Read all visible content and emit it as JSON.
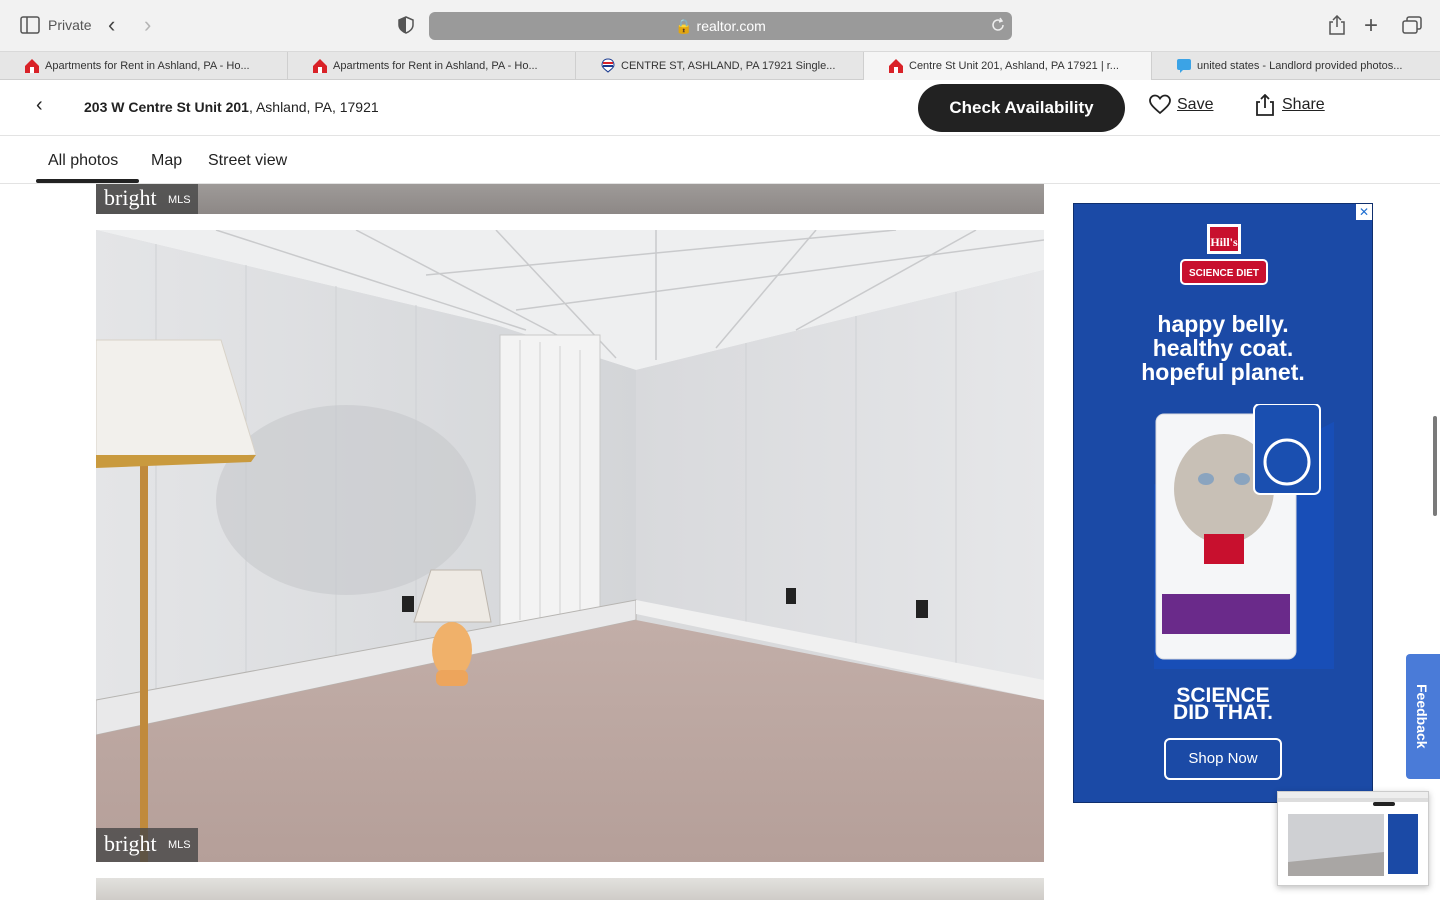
{
  "browser": {
    "private_label": "Private",
    "url": "realtor.com",
    "tabs": [
      {
        "title": "Apartments for Rent in Ashland, PA - Ho...",
        "icon": "realtor-house-icon"
      },
      {
        "title": "Apartments for Rent in Ashland, PA - Ho...",
        "icon": "realtor-house-icon"
      },
      {
        "title": "CENTRE ST, ASHLAND, PA 17921 Single...",
        "icon": "remax-balloon-icon"
      },
      {
        "title": "Centre St Unit 201, Ashland, PA 17921 | r...",
        "icon": "realtor-house-icon"
      },
      {
        "title": "united states - Landlord provided photos...",
        "icon": "stackexchange-icon"
      }
    ]
  },
  "listing": {
    "street": "203 W Centre St Unit 201",
    "locality": ", Ashland, PA, 17921",
    "check_availability": "Check Availability",
    "save": "Save",
    "share": "Share"
  },
  "subtabs": [
    "All photos",
    "Map",
    "Street view"
  ],
  "photos": {
    "badge_brand": "bright",
    "badge_suffix": "MLS"
  },
  "ad": {
    "close": "✕",
    "brand_line1": "Hill's",
    "brand_line2": "SCIENCE DIET",
    "headline": [
      "happy belly.",
      "healthy coat.",
      "hopeful planet."
    ],
    "tagline": [
      "SCIENCE",
      "DID THAT."
    ],
    "cta": "Shop Now",
    "accent": "#1b4aa6"
  },
  "feedback": "Feedback"
}
